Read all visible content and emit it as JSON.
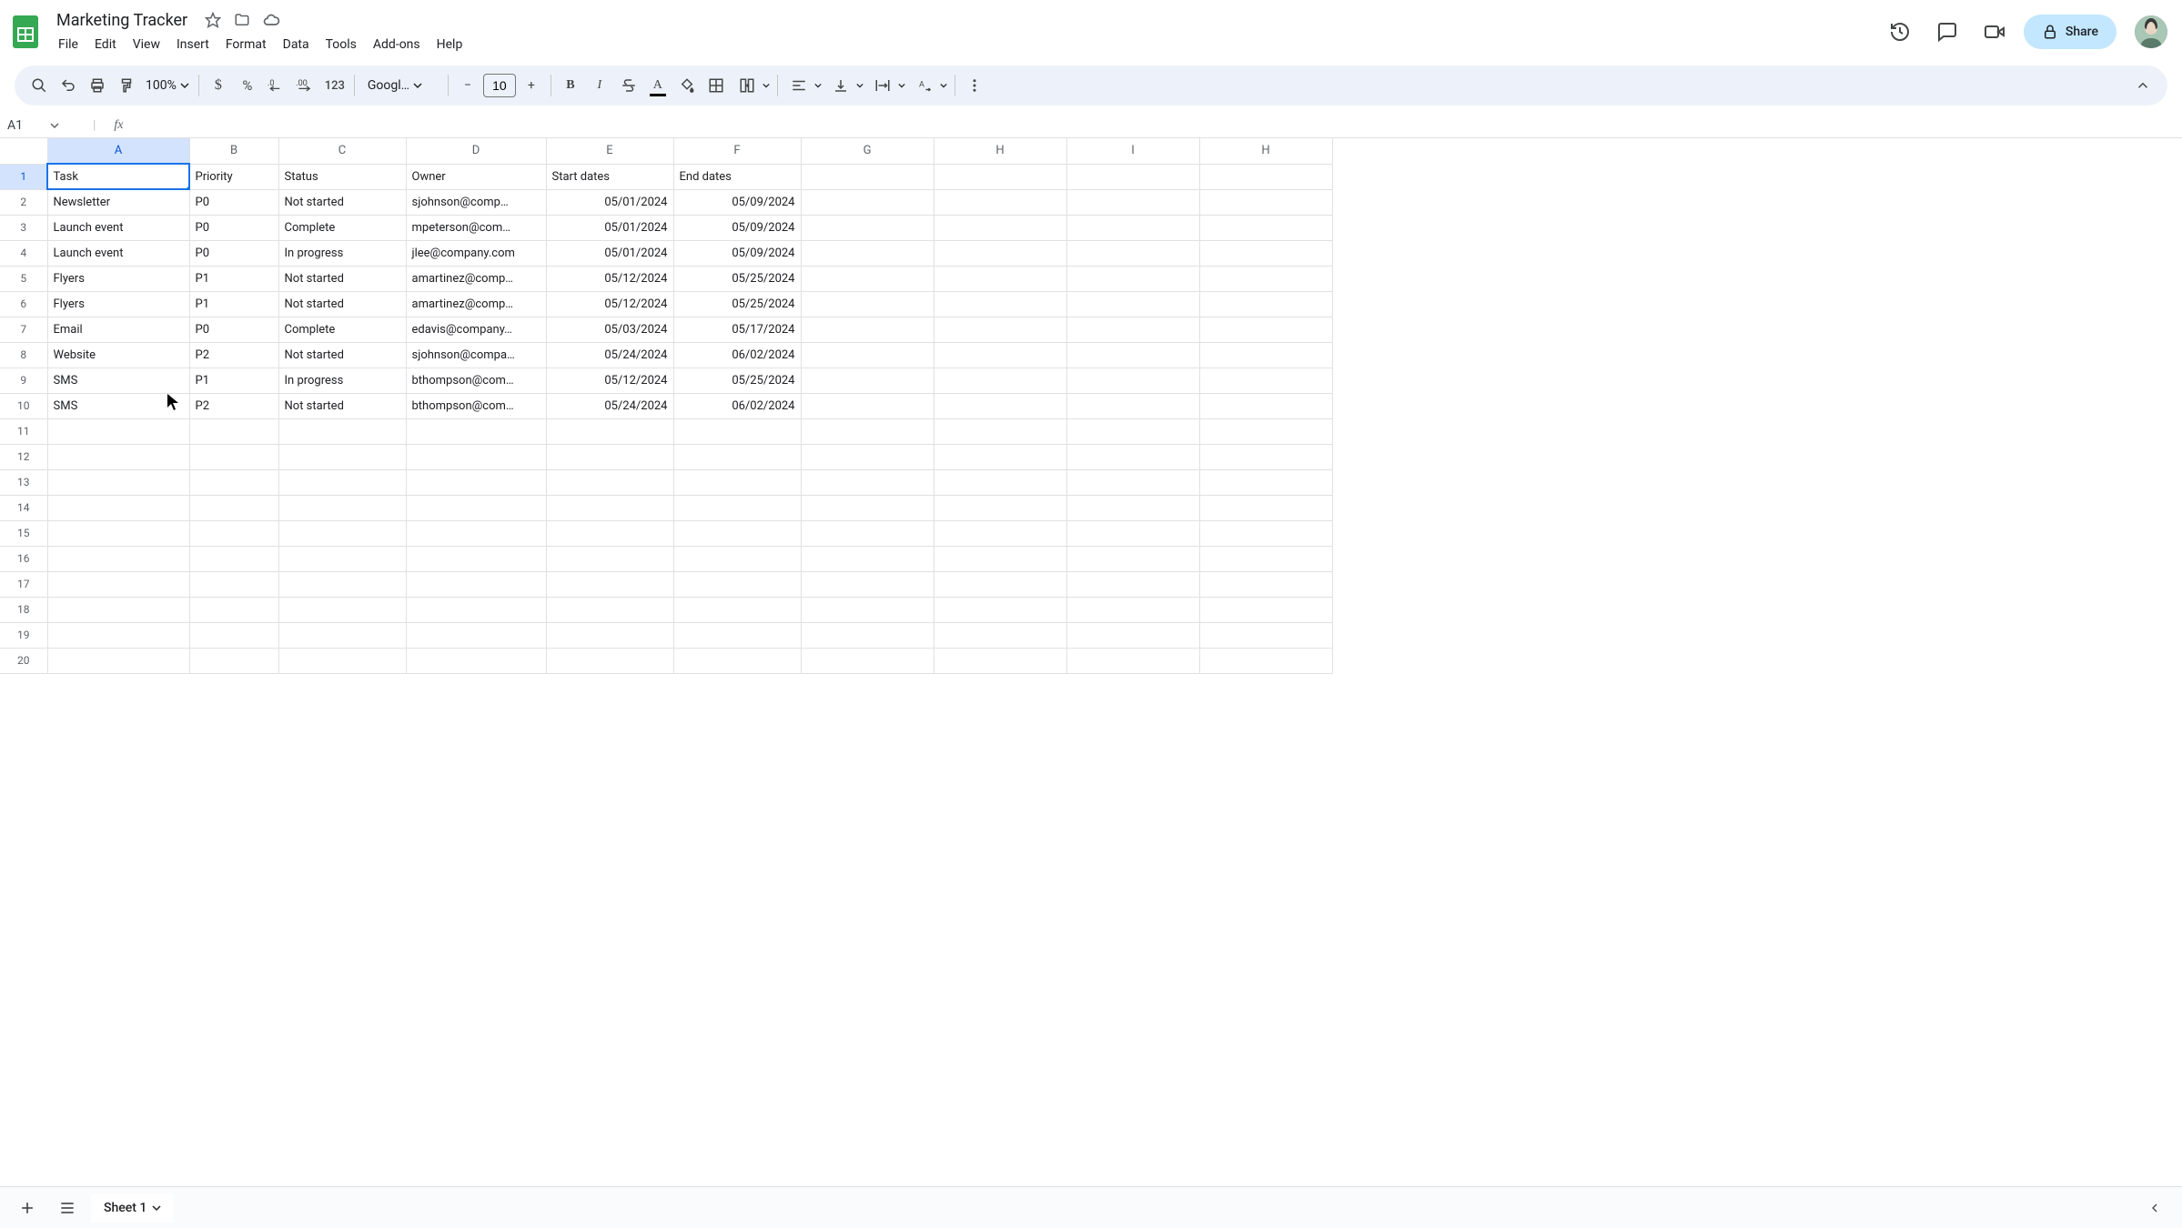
{
  "doc": {
    "title": "Marketing Tracker"
  },
  "menu": {
    "file": "File",
    "edit": "Edit",
    "view": "View",
    "insert": "Insert",
    "format": "Format",
    "data": "Data",
    "tools": "Tools",
    "addons": "Add-ons",
    "help": "Help"
  },
  "share": {
    "label": "Share"
  },
  "toolbar": {
    "zoom": "100%",
    "font": "Googl…",
    "font_size": "10"
  },
  "namebox": {
    "value": "A1"
  },
  "columns": [
    "A",
    "B",
    "C",
    "D",
    "E",
    "F",
    "G",
    "H",
    "I",
    "H"
  ],
  "selected_col_index": 0,
  "selected_row_index": 0,
  "row_count": 20,
  "headers": {
    "task": "Task",
    "priority": "Priority",
    "status": "Status",
    "owner": "Owner",
    "start": "Start dates",
    "end": "End dates"
  },
  "rows": [
    {
      "task": "Newsletter",
      "priority": "P0",
      "status": "Not started",
      "owner": "sjohnson@comp…",
      "start": "05/01/2024",
      "end": "05/09/2024"
    },
    {
      "task": "Launch event",
      "priority": "P0",
      "status": "Complete",
      "owner": "mpeterson@com…",
      "start": "05/01/2024",
      "end": "05/09/2024"
    },
    {
      "task": "Launch event",
      "priority": "P0",
      "status": "In progress",
      "owner": "jlee@company.com",
      "start": "05/01/2024",
      "end": "05/09/2024"
    },
    {
      "task": "Flyers",
      "priority": "P1",
      "status": "Not started",
      "owner": "amartinez@comp…",
      "start": "05/12/2024",
      "end": "05/25/2024"
    },
    {
      "task": "Flyers",
      "priority": "P1",
      "status": "Not started",
      "owner": "amartinez@comp…",
      "start": "05/12/2024",
      "end": "05/25/2024"
    },
    {
      "task": "Email",
      "priority": "P0",
      "status": "Complete",
      "owner": "edavis@company…",
      "start": "05/03/2024",
      "end": "05/17/2024"
    },
    {
      "task": "Website",
      "priority": "P2",
      "status": "Not started",
      "owner": "sjohnson@compa…",
      "start": "05/24/2024",
      "end": "06/02/2024"
    },
    {
      "task": "SMS",
      "priority": "P1",
      "status": "In progress",
      "owner": "bthompson@com…",
      "start": "05/12/2024",
      "end": "05/25/2024"
    },
    {
      "task": "SMS",
      "priority": "P2",
      "status": "Not started",
      "owner": "bthompson@com…",
      "start": "05/24/2024",
      "end": "06/02/2024"
    }
  ],
  "sheets": {
    "tab1": "Sheet 1"
  }
}
